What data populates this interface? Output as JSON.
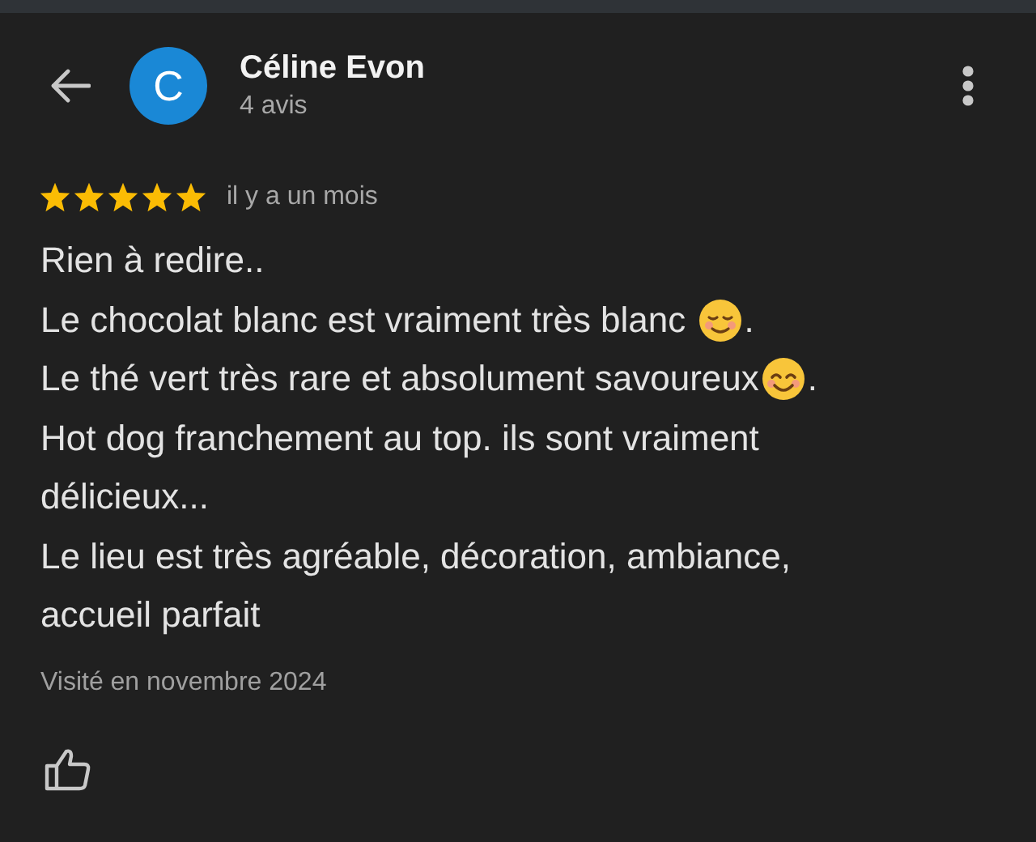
{
  "header": {
    "avatar_letter": "C",
    "name": "Céline Evon",
    "review_count": "4 avis"
  },
  "review": {
    "stars": 5,
    "time": "il y a un mois",
    "lines": [
      [
        {
          "kind": "text",
          "text": "Rien à redire.."
        }
      ],
      [
        {
          "kind": "text",
          "text": "Le chocolat blanc est vraiment très blanc "
        },
        {
          "kind": "relieved"
        },
        {
          "kind": "text",
          "text": "."
        }
      ],
      [
        {
          "kind": "text",
          "text": "Le thé vert très rare et absolument savoureux"
        },
        {
          "kind": "smile"
        },
        {
          "kind": "text",
          "text": "."
        }
      ],
      [
        {
          "kind": "text",
          "text": "Hot dog franchement au top. ils sont vraiment délicieux..."
        }
      ],
      [
        {
          "kind": "text",
          "text": "Le lieu est très agréable, décoration, ambiance, accueil parfait"
        }
      ]
    ],
    "visited": "Visité en novembre 2024"
  }
}
